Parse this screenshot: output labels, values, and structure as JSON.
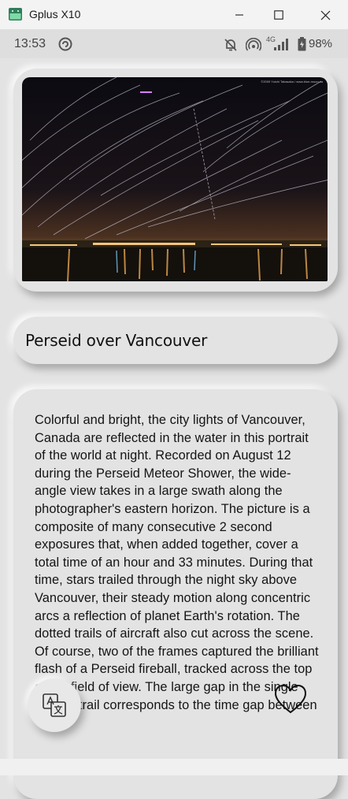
{
  "window": {
    "title": "Gplus X10",
    "icons": [
      "app-icon",
      "minimize-icon",
      "maximize-icon",
      "close-icon"
    ]
  },
  "statusbar": {
    "time": "13:53",
    "network_label": "4G",
    "battery": "98%",
    "icons": [
      "sync-icon",
      "notifications-off-icon",
      "hotspot-icon",
      "signal-icon",
      "battery-icon"
    ]
  },
  "image": {
    "credit": "©2009 Yuichi Takasaka / www.blue-moon.ca"
  },
  "article": {
    "title": "Perseid over Vancouver",
    "description": "Colorful and bright, the city lights of Vancouver, Canada are reflected in the water in this portrait of the world at night. Recorded on August 12 during the Perseid Meteor Shower, the wide-angle view takes in a large swath along the photographer's eastern horizon. The picture is a composite of many consecutive 2 second exposures that, when added together, cover a total time of an hour and 33 minutes. During that time, stars trailed through the night sky above Vancouver, their steady motion along concentric arcs a reflection of planet Earth's rotation. The dotted trails of aircraft also cut across the scene. Of course, two of the frames captured the brilliant flash of a Perseid fireball, tracked across the top of the field of view. The large gap in the single meteor trail corresponds to the time gap between"
  },
  "actions": {
    "translate_icon": "translate-icon",
    "favorite_icon": "heart-icon"
  },
  "colors": {
    "background": "#e3e3e3",
    "text": "#141414"
  }
}
